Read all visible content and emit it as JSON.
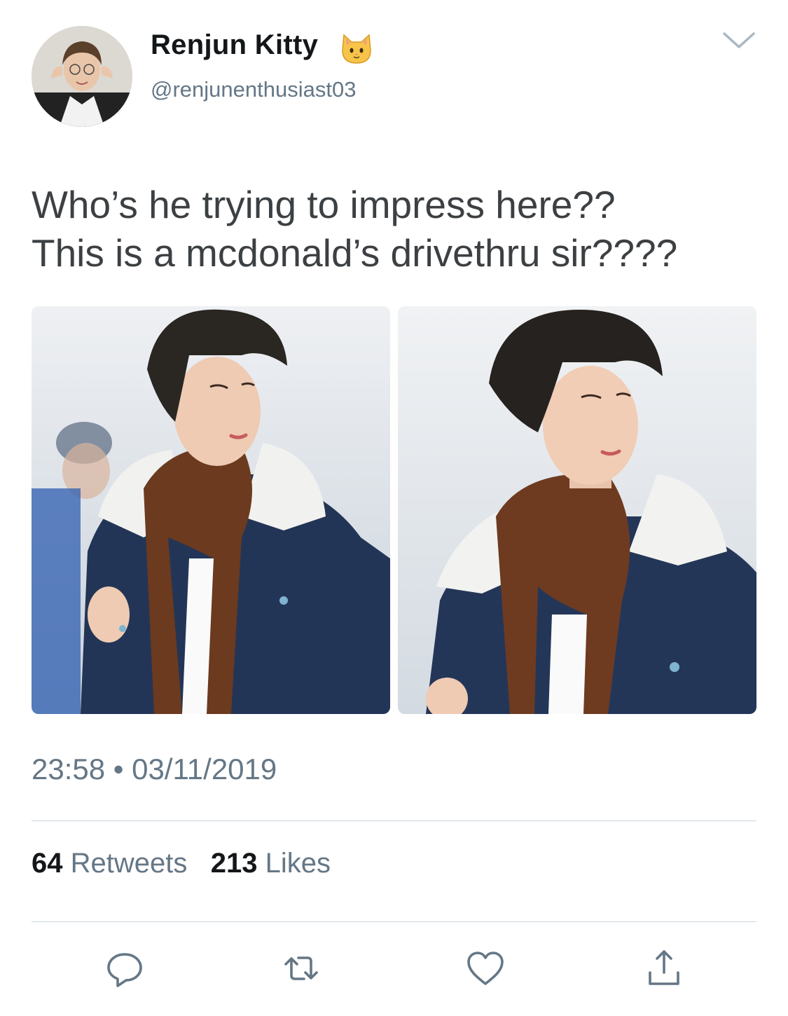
{
  "author": {
    "display_name": "Renjun Kitty",
    "handle": "@renjunenthusiast03",
    "emoji_icon": "cat-face-icon",
    "avatar_icon": "profile-photo"
  },
  "tweet": {
    "lines": [
      "Who’s he trying to impress here??",
      "This is a mcdonald’s drivethru sir????"
    ],
    "time": "23:58",
    "separator": "•",
    "date": "03/11/2019",
    "photos": [
      {
        "description_icon": "photo-man-brown-scarf-denim-jacket"
      },
      {
        "description_icon": "photo-man-brown-scarf-denim-jacket-closeup"
      }
    ]
  },
  "stats": {
    "retweets_count": "64",
    "retweets_label": "Retweets",
    "likes_count": "213",
    "likes_label": "Likes"
  },
  "actions": {
    "reply_icon": "reply-icon",
    "retweet_icon": "retweet-icon",
    "like_icon": "heart-icon",
    "share_icon": "share-icon"
  },
  "colors": {
    "text_primary": "#14171a",
    "text_secondary": "#657786",
    "tweet_text": "#3c4043",
    "divider": "#ccd6dd",
    "icon": "#657786"
  }
}
